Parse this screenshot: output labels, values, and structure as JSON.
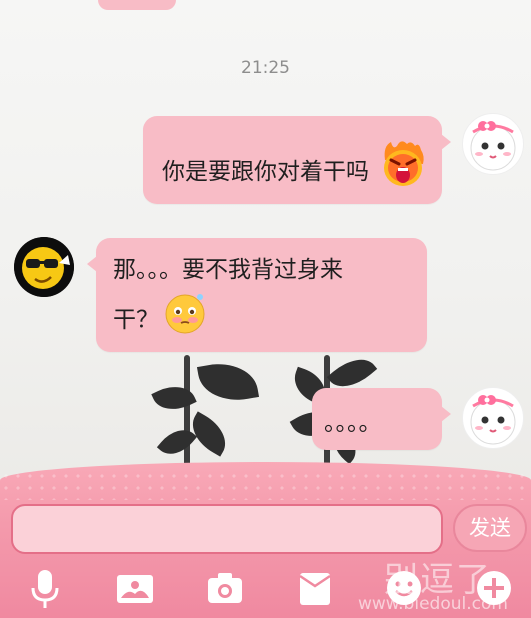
{
  "conversation": {
    "timestamp": "21:25",
    "messages": [
      {
        "side": "right",
        "text": "你是要跟你对着干吗",
        "sticker": "angry-face-icon"
      },
      {
        "side": "left",
        "line1": "那。。。要不我背过身来",
        "line2": "干？",
        "sticker": "flushed-face-icon"
      },
      {
        "side": "right",
        "text": "。。。。"
      }
    ]
  },
  "input": {
    "value": "",
    "send_label": "发送"
  },
  "toolbar": {
    "items": [
      "microphone-icon",
      "image-icon",
      "camera-icon",
      "envelope-icon",
      "smiley-icon",
      "plus-icon"
    ]
  },
  "watermark": {
    "text": "别逗了",
    "url": "www.biedoul.com"
  },
  "colors": {
    "bubble": "#f8bcc6",
    "input_bar": "#f49aac",
    "timestamp": "#8d8d8d"
  }
}
